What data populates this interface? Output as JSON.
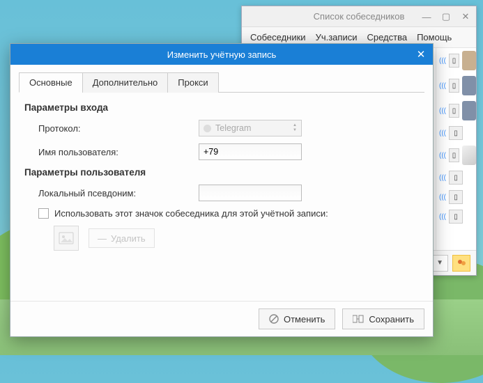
{
  "buddy_window": {
    "title": "Список собеседников",
    "menu": [
      "Собеседники",
      "Уч.записи",
      "Средства",
      "Помощь"
    ]
  },
  "dialog": {
    "title": "Изменить учётную запись",
    "tabs": [
      "Основные",
      "Дополнительно",
      "Прокси"
    ],
    "active_tab_index": 0,
    "login_section": {
      "title": "Параметры входа",
      "protocol_label": "Протокол:",
      "protocol_value": "Telegram",
      "username_label": "Имя пользователя:",
      "username_value": "+79"
    },
    "user_section": {
      "title": "Параметры пользователя",
      "alias_label": "Локальный псевдоним:",
      "alias_value": "",
      "use_icon_label": "Использовать этот значок собеседника для этой учётной записи:",
      "remove_icon_label": "Удалить"
    },
    "buttons": {
      "cancel": "Отменить",
      "save": "Сохранить"
    }
  }
}
